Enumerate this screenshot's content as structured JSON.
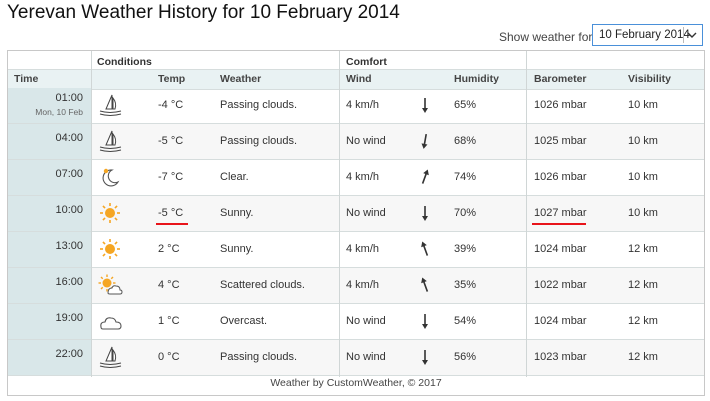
{
  "page": {
    "title": "Yerevan Weather History for 10 February 2014"
  },
  "selector": {
    "label": "Show weather for:",
    "value": "10 February 2014"
  },
  "table": {
    "groups": [
      "Conditions",
      "Comfort"
    ],
    "headers": [
      "Time",
      "Temp",
      "Weather",
      "Wind",
      "Humidity",
      "Barometer",
      "Visibility"
    ],
    "rows": [
      {
        "time": "01:00",
        "date": "Mon, 10 Feb",
        "icon": "night-cloud-icon",
        "temp": "-4 °C",
        "weather": "Passing clouds.",
        "wind": "4 km/h",
        "wind_dir_deg": 0,
        "humidity": "65%",
        "barometer": "1026 mbar",
        "visibility": "10 km"
      },
      {
        "time": "04:00",
        "icon": "night-cloud-icon",
        "temp": "-5 °C",
        "weather": "Passing clouds.",
        "wind": "No wind",
        "wind_dir_deg": 10,
        "humidity": "68%",
        "barometer": "1025 mbar",
        "visibility": "10 km"
      },
      {
        "time": "07:00",
        "icon": "moon-icon",
        "temp": "-7 °C",
        "weather": "Clear.",
        "wind": "4 km/h",
        "wind_dir_deg": 200,
        "humidity": "74%",
        "barometer": "1026 mbar",
        "visibility": "10 km"
      },
      {
        "time": "10:00",
        "icon": "sun-icon",
        "temp": "-5 °C",
        "weather": "Sunny.",
        "wind": "No wind",
        "wind_dir_deg": 0,
        "humidity": "70%",
        "barometer": "1027 mbar",
        "visibility": "10 km"
      },
      {
        "time": "13:00",
        "icon": "sun-icon",
        "temp": "2 °C",
        "weather": "Sunny.",
        "wind": "4 km/h",
        "wind_dir_deg": 160,
        "humidity": "39%",
        "barometer": "1024 mbar",
        "visibility": "12 km"
      },
      {
        "time": "16:00",
        "icon": "sun-cloud-icon",
        "temp": "4 °C",
        "weather": "Scattered clouds.",
        "wind": "4 km/h",
        "wind_dir_deg": 160,
        "humidity": "35%",
        "barometer": "1022 mbar",
        "visibility": "12 km"
      },
      {
        "time": "19:00",
        "icon": "cloud-icon",
        "temp": "1 °C",
        "weather": "Overcast.",
        "wind": "No wind",
        "wind_dir_deg": 0,
        "humidity": "54%",
        "barometer": "1024 mbar",
        "visibility": "12 km"
      },
      {
        "time": "22:00",
        "icon": "night-cloud-icon",
        "temp": "0 °C",
        "weather": "Passing clouds.",
        "wind": "No wind",
        "wind_dir_deg": 0,
        "humidity": "56%",
        "barometer": "1023 mbar",
        "visibility": "12 km"
      }
    ],
    "highlighted": {
      "row": 3,
      "columns": [
        "temp",
        "barometer"
      ],
      "color": "#e8141a"
    }
  },
  "footer": "Weather by CustomWeather, © 2017",
  "colors": {
    "time_column": "#d9e7e9",
    "header_row": "#e9f2f3",
    "accent": "#4a90d9",
    "sun": "#f5a623"
  }
}
